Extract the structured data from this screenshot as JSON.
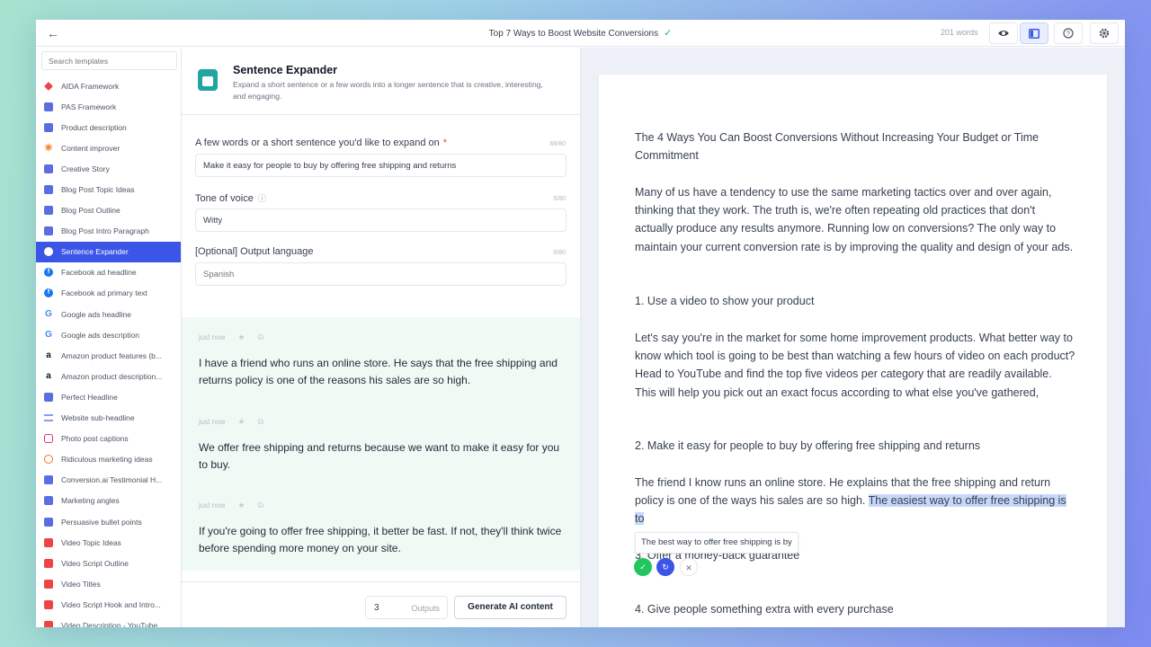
{
  "topbar": {
    "back_icon": "arrow-left-icon",
    "title": "Top 7 Ways to Boost Website Conversions",
    "saved_icon": "check-icon",
    "word_count": "201 words",
    "buttons": [
      "eye-icon",
      "layout-icon",
      "help-icon",
      "gear-icon"
    ]
  },
  "sidebar": {
    "search_placeholder": "Search templates",
    "items": [
      {
        "label": "AIDA Framework",
        "icon": "aida"
      },
      {
        "label": "PAS Framework",
        "icon": "doc"
      },
      {
        "label": "Product description",
        "icon": "doc"
      },
      {
        "label": "Content improver",
        "icon": "star"
      },
      {
        "label": "Creative Story",
        "icon": "doc"
      },
      {
        "label": "Blog Post Topic Ideas",
        "icon": "doc"
      },
      {
        "label": "Blog Post Outline",
        "icon": "doc"
      },
      {
        "label": "Blog Post Intro Paragraph",
        "icon": "doc"
      },
      {
        "label": "Sentence Expander",
        "icon": "sentence"
      },
      {
        "label": "Facebook ad headline",
        "icon": "fb"
      },
      {
        "label": "Facebook ad primary text",
        "icon": "fb"
      },
      {
        "label": "Google ads headline",
        "icon": "google"
      },
      {
        "label": "Google ads description",
        "icon": "google"
      },
      {
        "label": "Amazon product features (b...",
        "icon": "amazon"
      },
      {
        "label": "Amazon product description...",
        "icon": "amazon"
      },
      {
        "label": "Perfect Headline",
        "icon": "doc"
      },
      {
        "label": "Website sub-headline",
        "icon": "lines"
      },
      {
        "label": "Photo post captions",
        "icon": "insta"
      },
      {
        "label": "Ridiculous marketing ideas",
        "icon": "circle"
      },
      {
        "label": "Conversion.ai Testimonial H...",
        "icon": "doc"
      },
      {
        "label": "Marketing angles",
        "icon": "doc"
      },
      {
        "label": "Persuasive bullet points",
        "icon": "doc"
      },
      {
        "label": "Video Topic Ideas",
        "icon": "yt"
      },
      {
        "label": "Video Script Outline",
        "icon": "yt"
      },
      {
        "label": "Video Titles",
        "icon": "yt"
      },
      {
        "label": "Video Script Hook and Intro...",
        "icon": "yt"
      },
      {
        "label": "Video Description - YouTube",
        "icon": "yt"
      }
    ],
    "active_index": 8
  },
  "template": {
    "title": "Sentence Expander",
    "description": "Expand a short sentence or a few words into a longer sentence that is creative, interesting, and engaging.",
    "fields": [
      {
        "label": "A few words or a short sentence you'd like to expand on",
        "required": "*",
        "count": "68/80",
        "value": "Make it easy for people to buy by offering free shipping and returns"
      },
      {
        "label": "Tone of voice",
        "count": "5/80",
        "value": "Witty"
      },
      {
        "label": "[Optional] Output language",
        "count": "0/80",
        "placeholder": "Spanish"
      }
    ]
  },
  "outputs": [
    {
      "time": "just now",
      "text": "I have a friend who runs an online store. He says that the free shipping and returns policy is one of the reasons his sales are so high."
    },
    {
      "time": "just now",
      "text": "We offer free shipping and returns because we want to make it easy for you to buy."
    },
    {
      "time": "just now",
      "text": "If you're going to offer free shipping, it better be fast. If not, they'll think twice before spending more money on your site."
    }
  ],
  "generate": {
    "count": "3",
    "count_label": "Outputs",
    "button": "Generate AI content"
  },
  "editor": {
    "heading": "The 4 Ways You Can Boost Conversions Without Increasing Your Budget or Time Commitment",
    "p1": "Many of us have a tendency to use the same marketing tactics over and over again, thinking that they work. The truth is, we're often repeating old practices that don't actually produce any results anymore. Running low on conversions? The only way to maintain your current conversion rate is by improving the quality and design of your ads.",
    "h1": "1. Use a video to show your product",
    "p2": "Let's say you're in the market for some home improvement products. What better way to know which tool is going to be best than watching a few hours of video on each product? Head to YouTube and find the top five videos per category that are readily available. This will help you pick out an exact focus according to what else you've gathered,",
    "h2": "2. Make it easy for people to buy by offering free shipping and returns",
    "p3_plain": "The friend I know runs an online store. He explains that the free shipping and return policy is one of the ways his sales are so high.",
    "p3_highlight": "The easiest way to offer free shipping is to",
    "h3": "3. Offer a money-back guarantee",
    "h4": "4. Give people something extra with every purchase",
    "suggestion": "The best way to offer free shipping is by"
  }
}
